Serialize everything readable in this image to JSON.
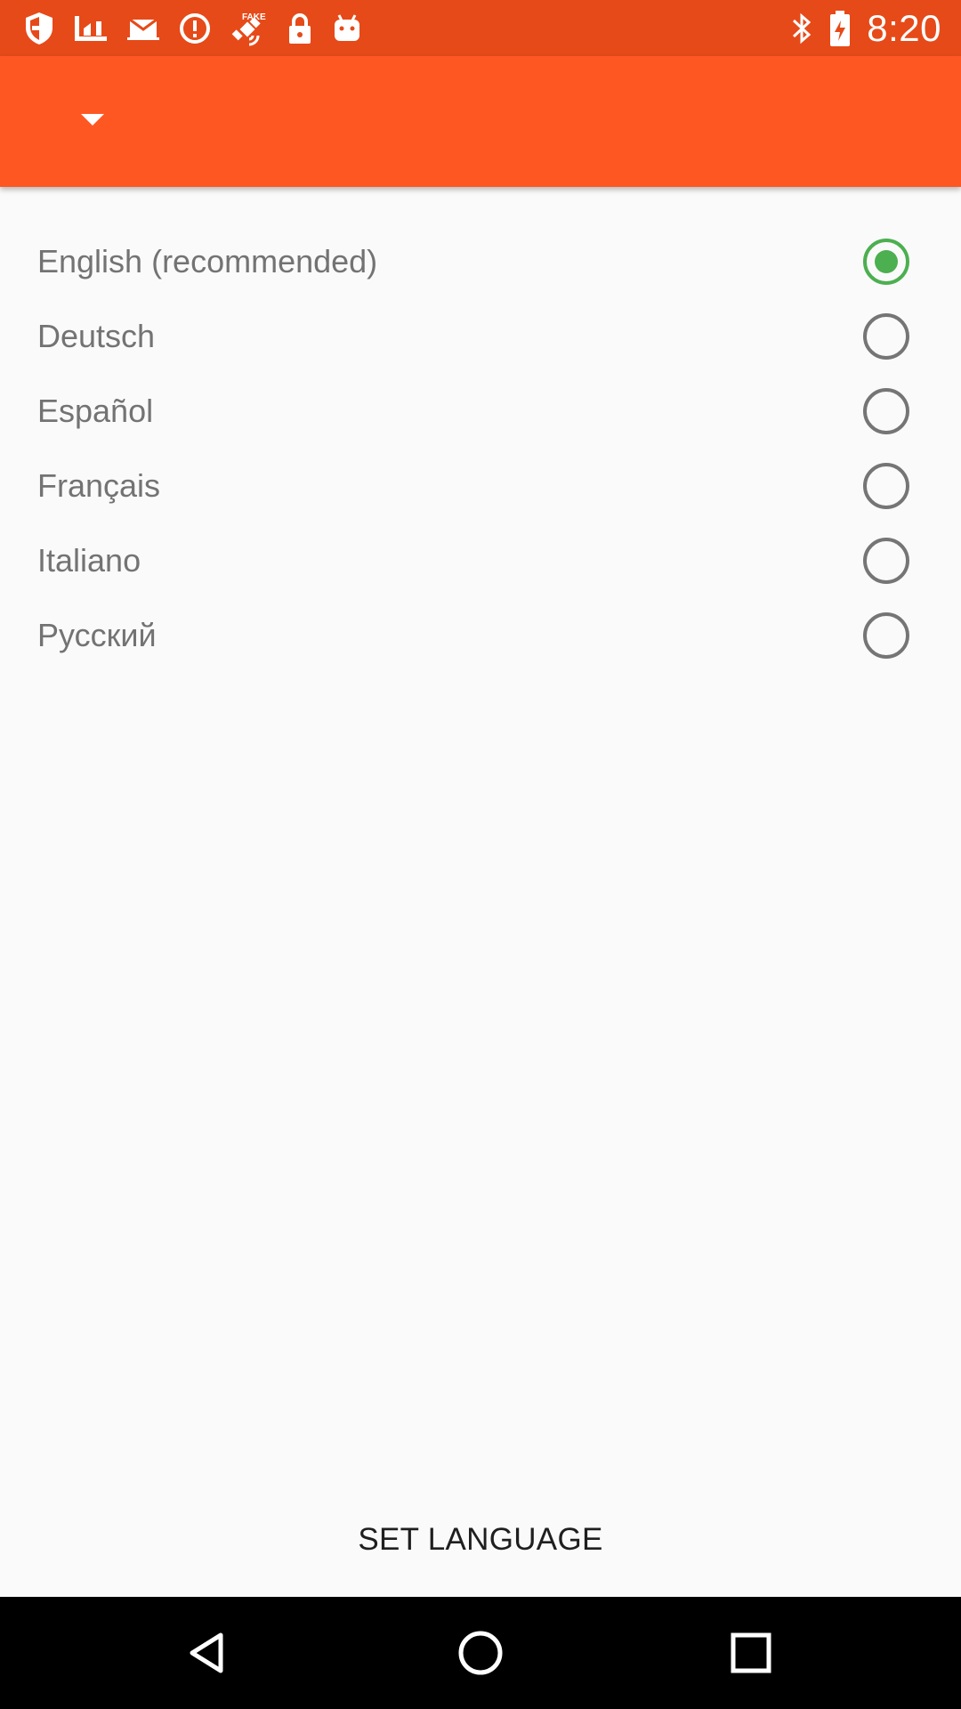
{
  "status_bar": {
    "time": "8:20",
    "left_icons": [
      "shield-icon",
      "chart-icon",
      "mail-icon",
      "alert-circle-icon",
      "fake-gps-icon",
      "lock-icon",
      "android-icon"
    ],
    "right_icons": [
      "bluetooth-icon",
      "battery-icon"
    ]
  },
  "app_bar": {
    "dropdown_icon": "dropdown-arrow-icon"
  },
  "languages": [
    {
      "label": "English (recommended)",
      "selected": true
    },
    {
      "label": "Deutsch",
      "selected": false
    },
    {
      "label": "Español",
      "selected": false
    },
    {
      "label": "Français",
      "selected": false
    },
    {
      "label": "Italiano",
      "selected": false
    },
    {
      "label": "Русский",
      "selected": false
    }
  ],
  "set_language_label": "SET LANGUAGE",
  "nav_bar": {
    "buttons": [
      "back-icon",
      "home-icon",
      "recents-icon"
    ]
  },
  "colors": {
    "status_bar": "#e64a19",
    "app_bar": "#ff5722",
    "radio_selected": "#4caf50",
    "radio_unselected": "#757575",
    "label_text": "#737373"
  }
}
